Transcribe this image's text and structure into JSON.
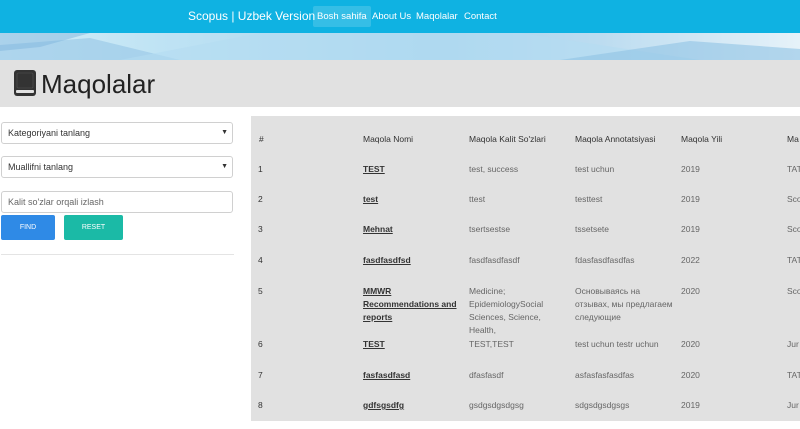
{
  "navbar": {
    "brand": "Scopus | Uzbek Version",
    "items": [
      {
        "label": "Bosh sahifa",
        "active": true
      },
      {
        "label": "About Us",
        "active": false
      },
      {
        "label": "Maqolalar",
        "active": false
      },
      {
        "label": "Contact",
        "active": false
      }
    ]
  },
  "page": {
    "title": "Maqolalar",
    "title_icon": "book-icon"
  },
  "filters": {
    "category_select": "Kategoriyani tanlang",
    "author_select": "Muallifni tanlang",
    "search_placeholder": "Kalit so'zlar orqali izlash",
    "find_label": "FIND",
    "reset_label": "RESET"
  },
  "table": {
    "headers": [
      "#",
      "Maqola Nomi",
      "Maqola Kalit So'zlari",
      "Maqola Annotatsiyasi",
      "Maqola Yili",
      "Ma"
    ],
    "rows": [
      {
        "num": "1",
        "title": "TEST",
        "keywords": "test, success",
        "annotation": "test uchun",
        "year": "2019",
        "extra": "TAT"
      },
      {
        "num": "2",
        "title": "test",
        "keywords": "ttest",
        "annotation": "testtest",
        "year": "2019",
        "extra": "Sco"
      },
      {
        "num": "3",
        "title": "Mehnat",
        "keywords": "tsertsestse",
        "annotation": "tssetsete",
        "year": "2019",
        "extra": "Sco"
      },
      {
        "num": "4",
        "title": "fasdfasdfsd",
        "keywords": "fasdfasdfasdf",
        "annotation": "fdasfasdfasdfas",
        "year": "2022",
        "extra": "TAT"
      },
      {
        "num": "5",
        "title": "MMWR Recommendations and reports",
        "keywords": "Medicine; EpidemiologySocial Sciences, Science, Health,",
        "annotation": "Основываясь на отзывах, мы предлагаем следующие",
        "year": "2020",
        "extra": "Sco"
      },
      {
        "num": "6",
        "title": "TEST",
        "keywords": "TEST,TEST",
        "annotation": "test uchun testr uchun",
        "year": "2020",
        "extra": "Jur"
      },
      {
        "num": "7",
        "title": "fasfasdfasd",
        "keywords": "dfasfasdf",
        "annotation": "asfasfasfasdfas",
        "year": "2020",
        "extra": "TAT"
      },
      {
        "num": "8",
        "title": "gdfsgsdfg",
        "keywords": "gsdgsdgsdgsg",
        "annotation": "sdgsdgsdgsgs",
        "year": "2019",
        "extra": "Jur"
      }
    ]
  }
}
